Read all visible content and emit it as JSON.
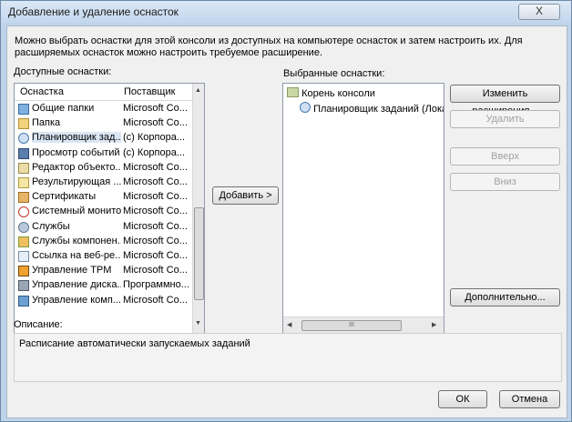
{
  "window": {
    "title": "Добавление и удаление оснасток",
    "close_glyph": "X"
  },
  "intro_text": "Можно выбрать оснастки для этой консоли из доступных на компьютере оснасток и затем настроить их. Для расширяемых оснасток можно настроить требуемое расширение.",
  "available": {
    "label": "Доступные оснастки:",
    "columns": [
      "Оснастка",
      "Поставщик"
    ],
    "rows": [
      {
        "name": "Общие папки",
        "vendor": "Microsoft Co...",
        "icon": "shared-folders-icon"
      },
      {
        "name": "Папка",
        "vendor": "Microsoft Co...",
        "icon": "folder-icon"
      },
      {
        "name": "Планировщик зад...",
        "vendor": "(c) Корпора...",
        "icon": "task-scheduler-icon"
      },
      {
        "name": "Просмотр событий",
        "vendor": "(c) Корпора...",
        "icon": "event-viewer-icon"
      },
      {
        "name": "Редактор объекто...",
        "vendor": "Microsoft Co...",
        "icon": "object-editor-icon"
      },
      {
        "name": "Результирующая ...",
        "vendor": "Microsoft Co...",
        "icon": "rsop-icon"
      },
      {
        "name": "Сертификаты",
        "vendor": "Microsoft Co...",
        "icon": "certificates-icon"
      },
      {
        "name": "Системный монитор",
        "vendor": "Microsoft Co...",
        "icon": "system-monitor-icon"
      },
      {
        "name": "Службы",
        "vendor": "Microsoft Co...",
        "icon": "services-icon"
      },
      {
        "name": "Службы компонен...",
        "vendor": "Microsoft Co...",
        "icon": "component-services-icon"
      },
      {
        "name": "Ссылка на веб-ре...",
        "vendor": "Microsoft Co...",
        "icon": "web-link-icon"
      },
      {
        "name": "Управление TPM",
        "vendor": "Microsoft Co...",
        "icon": "tpm-icon"
      },
      {
        "name": "Управление диска...",
        "vendor": "Программно...",
        "icon": "disk-management-icon"
      },
      {
        "name": "Управление комп...",
        "vendor": "Microsoft Co...",
        "icon": "computer-management-icon"
      }
    ],
    "selected_index": 2
  },
  "add_button": "Добавить >",
  "selected": {
    "label": "Выбранные оснастки:",
    "root": "Корень консоли",
    "child": "Планировщик заданий (Локальн",
    "hscroll_thumb": "III"
  },
  "buttons": {
    "edit_extensions": "Изменить расширения...",
    "remove": "Удалить",
    "up": "Вверх",
    "down": "Вниз",
    "advanced": "Дополнительно...",
    "ok": "ОК",
    "cancel": "Отмена"
  },
  "description": {
    "label": "Описание:",
    "text": "Расписание автоматически запускаемых заданий"
  },
  "colors": {
    "window_frame": "#bfd4ea",
    "client_bg": "#f0f0f0",
    "selection": "#dbe6f4"
  }
}
